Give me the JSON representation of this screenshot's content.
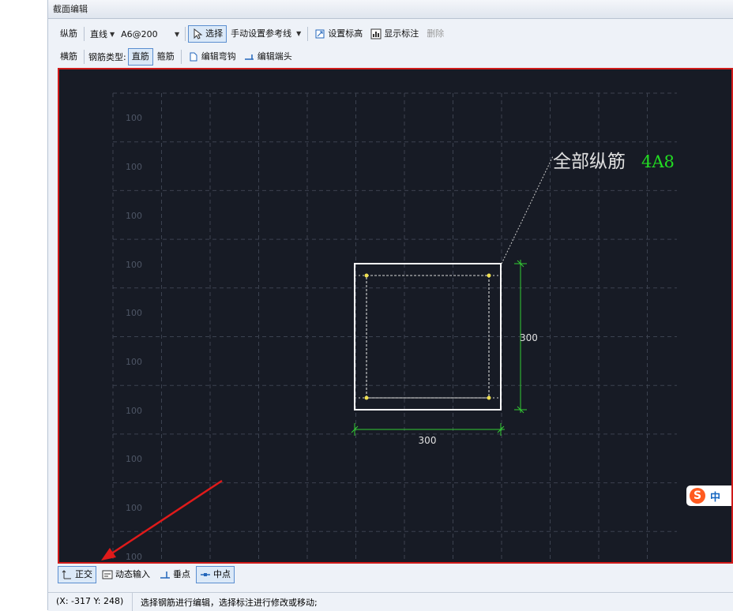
{
  "window": {
    "title": "截面编辑"
  },
  "toolbar1": {
    "longitudinal_rebar": "纵筋",
    "line_mode": "直线",
    "spec_value": "A6@200",
    "select": "选择",
    "set_reference_line": "手动设置参考线",
    "set_elevation": "设置标高",
    "show_annotation": "显示标注",
    "delete": "删除"
  },
  "toolbar2": {
    "transverse_rebar": "横筋",
    "rebar_type_label": "钢筋类型:",
    "straight_bar": "直筋",
    "stirrup": "箍筋",
    "edit_hook": "编辑弯钩",
    "edit_end": "编辑端头"
  },
  "canvas": {
    "grid_labels": [
      "100",
      "100",
      "100",
      "100",
      "100",
      "100",
      "100",
      "100",
      "100",
      "100"
    ],
    "annotation_text": "全部纵筋",
    "annotation_value": "4A8",
    "dim_width": "300",
    "dim_height": "300",
    "colors": {
      "background": "#171b25",
      "annotation_value": "#22dd22",
      "dimension": "#33cc33",
      "section": "#ffffff",
      "rebar_point": "#f0e050",
      "border": "#d01a1a"
    }
  },
  "ime": {
    "label": "中"
  },
  "bottom_toolbar": {
    "orthogonal": "正交",
    "dynamic_input": "动态输入",
    "perpendicular": "垂点",
    "midpoint": "中点"
  },
  "status": {
    "coords": "(X: -317 Y: 248)",
    "message": "选择钢筋进行编辑，选择标注进行修改或移动;"
  }
}
